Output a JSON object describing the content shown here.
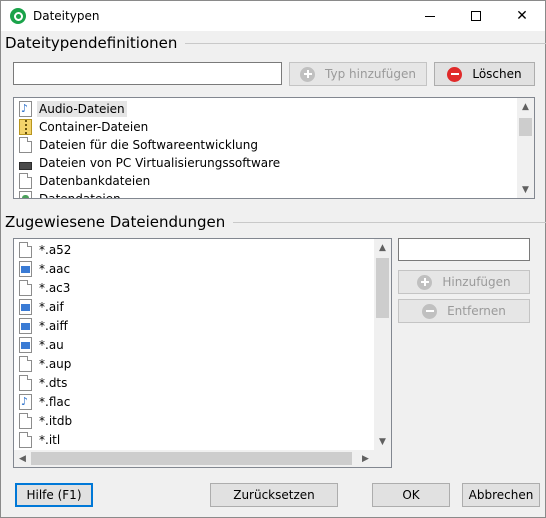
{
  "window": {
    "title": "Dateitypen",
    "minimize_glyph": "—",
    "close_glyph": "✕"
  },
  "definitions": {
    "section_label": "Dateitypendefinitionen",
    "input_value": "",
    "add_button_label": "Typ hinzufügen",
    "delete_button_label": "Löschen",
    "types": [
      {
        "label": "Audio-Dateien",
        "icon": "audio-icon",
        "selected": true
      },
      {
        "label": "Container-Dateien",
        "icon": "zip-icon",
        "selected": false
      },
      {
        "label": "Dateien für die Softwareentwicklung",
        "icon": "document-icon",
        "selected": false
      },
      {
        "label": "Dateien von PC Virtualisierungssoftware",
        "icon": "drive-icon",
        "selected": false
      },
      {
        "label": "Datenbankdateien",
        "icon": "document-icon",
        "selected": false
      },
      {
        "label": "Datendateien",
        "icon": "database-icon",
        "selected": false
      }
    ]
  },
  "extensions": {
    "section_label": "Zugewiesene Dateiendungen",
    "input_value": "",
    "add_button_label": "Hinzufügen",
    "remove_button_label": "Entfernen",
    "items": [
      {
        "label": "*.a52",
        "icon": "document-icon"
      },
      {
        "label": "*.aac",
        "icon": "media-icon"
      },
      {
        "label": "*.ac3",
        "icon": "document-icon"
      },
      {
        "label": "*.aif",
        "icon": "media-icon"
      },
      {
        "label": "*.aiff",
        "icon": "media-icon"
      },
      {
        "label": "*.au",
        "icon": "media-icon"
      },
      {
        "label": "*.aup",
        "icon": "document-icon"
      },
      {
        "label": "*.dts",
        "icon": "document-icon"
      },
      {
        "label": "*.flac",
        "icon": "audio-icon"
      },
      {
        "label": "*.itdb",
        "icon": "document-icon"
      },
      {
        "label": "*.itl",
        "icon": "document-icon"
      }
    ]
  },
  "footer": {
    "help_label": "Hilfe (F1)",
    "reset_label": "Zurücksetzen",
    "ok_label": "OK",
    "cancel_label": "Abbrechen"
  },
  "colors": {
    "accent": "#0078d7",
    "delete_icon": "#e02a2a",
    "app_icon": "#1aa34a"
  }
}
